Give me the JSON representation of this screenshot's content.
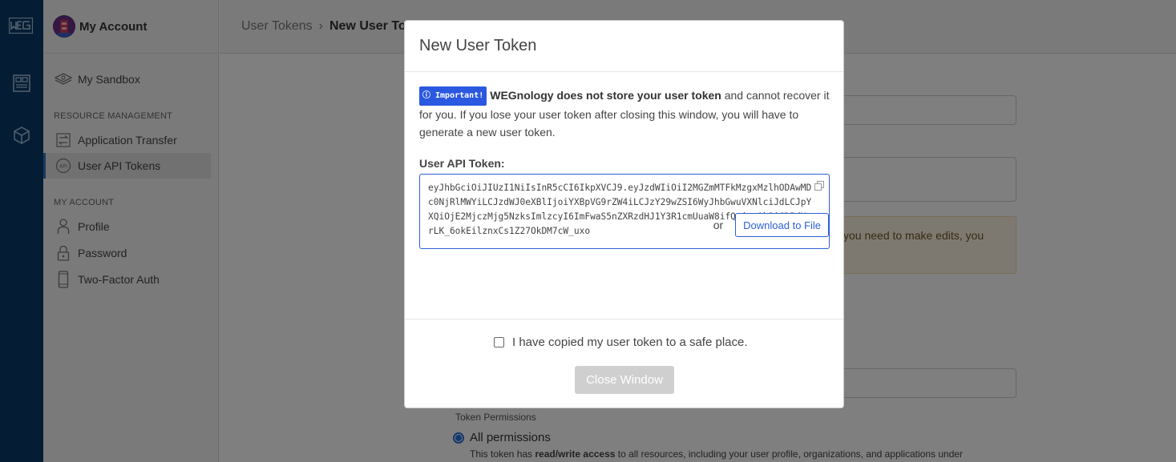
{
  "sidebar": {
    "account_title": "My Account",
    "sandbox_label": "My Sandbox",
    "resource_section": "RESOURCE MANAGEMENT",
    "resource_items": [
      {
        "label": "Application Transfer"
      },
      {
        "label": "User API Tokens"
      }
    ],
    "account_section": "MY ACCOUNT",
    "account_items": [
      {
        "label": "Profile"
      },
      {
        "label": "Password"
      },
      {
        "label": "Two-Factor Auth"
      }
    ]
  },
  "breadcrumb": {
    "parent": "User Tokens",
    "separator": "›",
    "current": "New User Tok"
  },
  "background": {
    "warning_text": "you need to make edits, you",
    "permissions_label": "Token Permissions",
    "all_permissions_label": "All permissions",
    "perm_desc_prefix": "This token has ",
    "perm_desc_bold": "read/write access",
    "perm_desc_suffix": " to all resources, including your user profile, organizations, and applications under"
  },
  "modal": {
    "title": "New User Token",
    "badge": "ⓘ Important!",
    "notice_bold": "WEGnology does not store your user token",
    "notice_rest": " and cannot recover it for you. If you lose your user token after closing this window, you will have to generate a new user token.",
    "token_label": "User API Token:",
    "token_value": "eyJhbGciOiJIUzI1NiIsInR5cCI6IkpXVCJ9.eyJzdWIiOiI2MGZmMTFkMzgxMzlhODAwMDc0NjRlMWYiLCJzdWJ0eXBlIjoiYXBpVG9rZW4iLCJzY29wZSI6WyJhbGwuVXNlciJdLCJpYXQiOjE2MjczMjg5NzksImlzcyI6ImFwaS5nZXRzdHJ1Y3R1cmUuaW8ifQ.josOk2i6DPdXyrLK_6okEilznxCs1Z27OkDM7cW_uxo",
    "or_text": "or",
    "download_label": "Download to File",
    "checkbox_label": "I have copied my user token to a safe place.",
    "close_label": "Close Window"
  },
  "colors": {
    "rail": "#0a3a68",
    "accent": "#2c5fd8",
    "disabled_button": "#cfcfcf"
  }
}
